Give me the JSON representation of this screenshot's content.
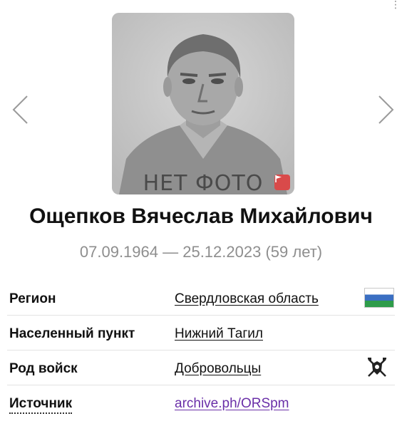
{
  "corner_mark": "⋮",
  "photo": {
    "placeholder_text": "НЕТ ФОТО",
    "flag_icon": "flag-icon",
    "flag_color": "#d94a4a"
  },
  "nav": {
    "prev_icon": "chevron-left-icon",
    "next_icon": "chevron-right-icon"
  },
  "person": {
    "name": "Ощепков Вячеслав Михайлович",
    "dates": "07.09.1964 — 25.12.2023 (59 лет)"
  },
  "details": [
    {
      "label": "Регион",
      "value": "Свердловская область",
      "icon": "sverdlovsk-flag-icon"
    },
    {
      "label": "Населенный пункт",
      "value": "Нижний Тагил"
    },
    {
      "label": "Род войск",
      "value": "Добровольцы",
      "icon": "volunteers-emblem-icon"
    },
    {
      "label": "Источник",
      "value": "archive.ph/ORSpm",
      "link_color": "#6a2fa8"
    }
  ]
}
